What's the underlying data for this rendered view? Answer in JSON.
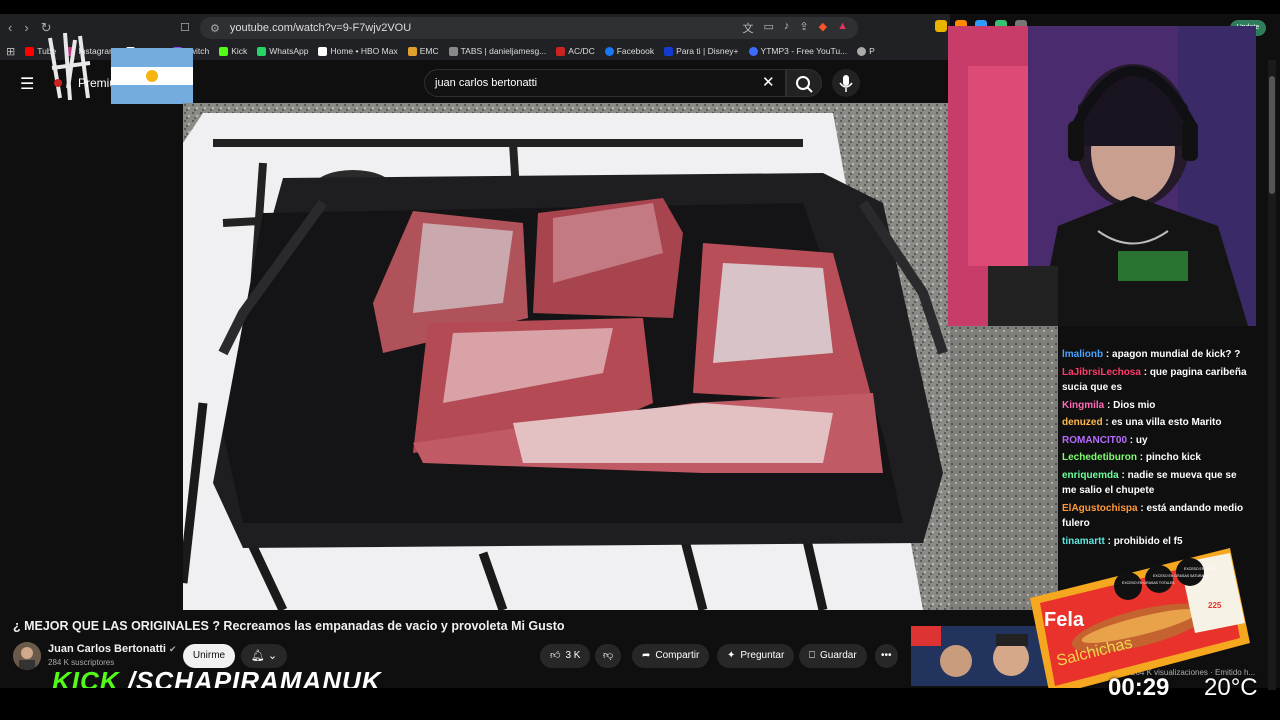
{
  "browser": {
    "url": "youtube.com/watch?v=9-F7wjv2VOU",
    "update_label": "Update",
    "bookmarks": [
      {
        "label": "Tube",
        "color": "#ff0000"
      },
      {
        "label": "Instagram",
        "color": "#c13584"
      },
      {
        "label": "Twitter",
        "color": "#ffffff"
      },
      {
        "label": "Twitch",
        "color": "#9146ff"
      },
      {
        "label": "Kick",
        "color": "#53fc18"
      },
      {
        "label": "WhatsApp",
        "color": "#25d366"
      },
      {
        "label": "Home • HBO Max",
        "color": "#ffffff"
      },
      {
        "label": "EMC",
        "color": "#e0a030"
      },
      {
        "label": "TABS | danieljamesg...",
        "color": "#888888"
      },
      {
        "label": "AC/DC",
        "color": "#cc2222"
      },
      {
        "label": "Facebook",
        "color": "#1877f2"
      },
      {
        "label": "Para ti | Disney+",
        "color": "#113ccf"
      },
      {
        "label": "YTMP3 - Free YouTu...",
        "color": "#3b6bff"
      },
      {
        "label": "P",
        "color": "#aaaaaa"
      }
    ]
  },
  "youtube": {
    "premium_label": "Premium",
    "search_query": "juan carlos bertonatti",
    "video_title": "¿ MEJOR QUE LAS ORIGINALES ? Recreamos las empanadas de vacio y provoleta Mi Gusto",
    "channel_name": "Juan Carlos Bertonatti",
    "subscribers": "284 K suscriptores",
    "join_label": "Unirme",
    "likes": "3 K",
    "share_label": "Compartir",
    "ask_label": "Preguntar",
    "save_label": "Guardar",
    "more_label": "•••",
    "rec_meta": "264 K visualizaciones · Emitido h..."
  },
  "chat": [
    {
      "user": "lmalionb",
      "color": "#4aa3ff",
      "msg": "apagon mundial de kick? ?"
    },
    {
      "user": "LaJibrsiLechosa",
      "color": "#ff3b6b",
      "msg": "que pagina caribeña sucia que es"
    },
    {
      "user": "Kingmila",
      "color": "#ff6bb5",
      "msg": "Dios mio"
    },
    {
      "user": "denuzed",
      "color": "#ffb84d",
      "msg": "es una villa esto Marito"
    },
    {
      "user": "ROMANCIT00",
      "color": "#b56bff",
      "msg": "uy"
    },
    {
      "user": "Lechedetiburon",
      "color": "#7cff6b",
      "msg": "pincho kick"
    },
    {
      "user": "enriquemda",
      "color": "#6bff9c",
      "msg": "nadie se mueva que se me salio el chupete"
    },
    {
      "user": "ElAgustochispa",
      "color": "#ff9a3b",
      "msg": "está andando medio fulero"
    },
    {
      "user": "tinamartt",
      "color": "#5ee8e0",
      "msg": "prohibido el f5"
    }
  ],
  "overlay": {
    "kick_word": "KICK",
    "channel_handle": "/SCHAPIRAMANUK",
    "clock": "00:29",
    "temperature": "20°C",
    "brand": "Fela",
    "product": "Salchichas",
    "price": "225",
    "warnings": [
      "EXCESO EN GRASAS TOTALES",
      "EXCESO EN GRASAS SATURADAS",
      "EXCESO EN SODIO"
    ]
  }
}
